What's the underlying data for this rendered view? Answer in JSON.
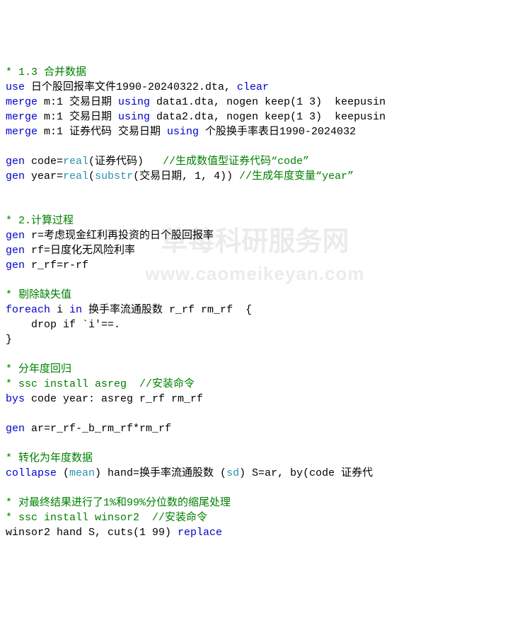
{
  "lines": [
    {
      "seg": [
        {
          "c": "cm",
          "t": "* 1.3 合并数据"
        }
      ]
    },
    {
      "seg": [
        {
          "c": "kw",
          "t": "use"
        },
        {
          "t": " 日个股回报率文件1990-20240322.dta, "
        },
        {
          "c": "kw",
          "t": "clear"
        }
      ]
    },
    {
      "seg": [
        {
          "c": "kw",
          "t": "merge"
        },
        {
          "t": " m:1 交易日期 "
        },
        {
          "c": "kw",
          "t": "using"
        },
        {
          "t": " data1.dta, nogen keep(1 3)  keepusin"
        }
      ]
    },
    {
      "seg": [
        {
          "c": "kw",
          "t": "merge"
        },
        {
          "t": " m:1 交易日期 "
        },
        {
          "c": "kw",
          "t": "using"
        },
        {
          "t": " data2.dta, nogen keep(1 3)  keepusin"
        }
      ]
    },
    {
      "seg": [
        {
          "c": "kw",
          "t": "merge"
        },
        {
          "t": " m:1 证券代码 交易日期 "
        },
        {
          "c": "kw",
          "t": "using"
        },
        {
          "t": " 个股换手率表日1990-2024032"
        }
      ]
    },
    {
      "seg": [
        {
          "t": ""
        }
      ]
    },
    {
      "seg": [
        {
          "c": "kw",
          "t": "gen"
        },
        {
          "t": " code="
        },
        {
          "c": "fn",
          "t": "real"
        },
        {
          "t": "(证券代码)   "
        },
        {
          "c": "cm",
          "t": "//生成数值型证券代码“code”"
        }
      ]
    },
    {
      "seg": [
        {
          "c": "kw",
          "t": "gen"
        },
        {
          "t": " year="
        },
        {
          "c": "fn",
          "t": "real"
        },
        {
          "t": "("
        },
        {
          "c": "fn",
          "t": "substr"
        },
        {
          "t": "(交易日期, 1, 4)) "
        },
        {
          "c": "cm",
          "t": "//生成年度变量“year”"
        }
      ]
    },
    {
      "seg": [
        {
          "t": ""
        }
      ]
    },
    {
      "seg": [
        {
          "t": ""
        }
      ]
    },
    {
      "seg": [
        {
          "c": "cm",
          "t": "* 2.计算过程"
        }
      ]
    },
    {
      "seg": [
        {
          "c": "kw",
          "t": "gen"
        },
        {
          "t": " r=考虑现金红利再投资的日个股回报率"
        }
      ]
    },
    {
      "seg": [
        {
          "c": "kw",
          "t": "gen"
        },
        {
          "t": " rf=日度化无风险利率"
        }
      ]
    },
    {
      "seg": [
        {
          "c": "kw",
          "t": "gen"
        },
        {
          "t": " r_rf=r-rf"
        }
      ]
    },
    {
      "seg": [
        {
          "t": ""
        }
      ]
    },
    {
      "seg": [
        {
          "c": "cm",
          "t": "* 剔除缺失值"
        }
      ]
    },
    {
      "seg": [
        {
          "c": "kw",
          "t": "foreach"
        },
        {
          "t": " i "
        },
        {
          "c": "kw",
          "t": "in"
        },
        {
          "t": " 换手率流通股数 r_rf rm_rf  {"
        }
      ]
    },
    {
      "seg": [
        {
          "t": "    drop if `i'==."
        }
      ]
    },
    {
      "seg": [
        {
          "t": "}"
        }
      ]
    },
    {
      "seg": [
        {
          "t": ""
        }
      ]
    },
    {
      "seg": [
        {
          "c": "cm",
          "t": "* 分年度回归"
        }
      ]
    },
    {
      "seg": [
        {
          "c": "cm",
          "t": "* ssc install asreg  //安装命令"
        }
      ]
    },
    {
      "seg": [
        {
          "c": "kw",
          "t": "bys"
        },
        {
          "t": " code year: asreg r_rf rm_rf"
        }
      ]
    },
    {
      "seg": [
        {
          "t": ""
        }
      ]
    },
    {
      "seg": [
        {
          "c": "kw",
          "t": "gen"
        },
        {
          "t": " ar=r_rf-_b_rm_rf*rm_rf"
        }
      ]
    },
    {
      "seg": [
        {
          "t": ""
        }
      ]
    },
    {
      "seg": [
        {
          "c": "cm",
          "t": "* 转化为年度数据"
        }
      ]
    },
    {
      "seg": [
        {
          "c": "kw",
          "t": "collapse"
        },
        {
          "t": " ("
        },
        {
          "c": "fn",
          "t": "mean"
        },
        {
          "t": ") hand=换手率流通股数 ("
        },
        {
          "c": "fn",
          "t": "sd"
        },
        {
          "t": ") S=ar, by(code 证券代"
        }
      ]
    },
    {
      "seg": [
        {
          "t": ""
        }
      ]
    },
    {
      "seg": [
        {
          "c": "cm",
          "t": "* 对最终结果进行了1%和99%分位数的缩尾处理"
        }
      ]
    },
    {
      "seg": [
        {
          "c": "cm",
          "t": "* ssc install winsor2  //安装命令"
        }
      ]
    },
    {
      "seg": [
        {
          "t": "winsor2 hand S, cuts(1 99) "
        },
        {
          "c": "kw",
          "t": "replace"
        }
      ]
    }
  ],
  "watermark": {
    "line1": "草莓科研服务网",
    "line2": "www.caomeikeyan.com"
  }
}
